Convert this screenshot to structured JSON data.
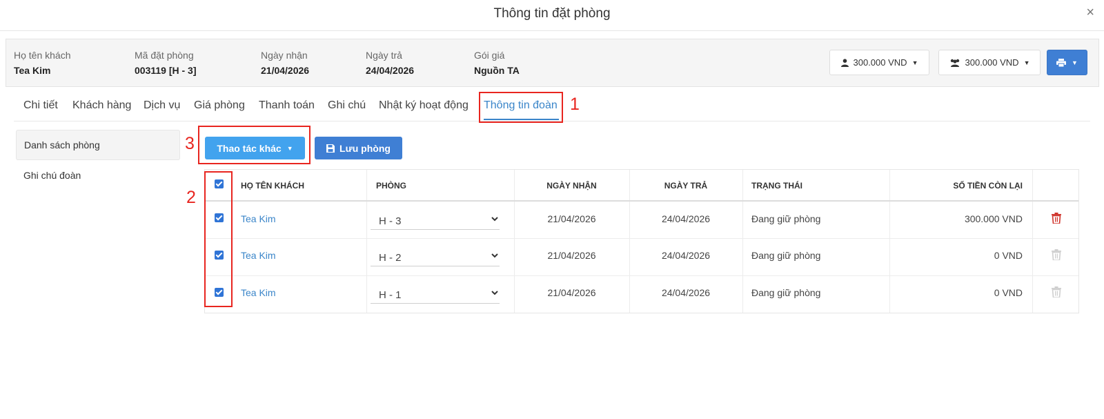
{
  "modal": {
    "title": "Thông tin đặt phòng",
    "close": "×"
  },
  "info": {
    "guest_label": "Họ tên khách",
    "guest_value": "Tea Kim",
    "code_label": "Mã đặt phòng",
    "code_value": "003119 [H - 3]",
    "checkin_label": "Ngày nhận",
    "checkin_value": "21/04/2026",
    "checkout_label": "Ngày trả",
    "checkout_value": "24/04/2026",
    "rate_label": "Gói giá",
    "rate_value": "Nguồn TA",
    "amount_single": "300.000 VND",
    "amount_group": "300.000 VND"
  },
  "tabs": [
    "Chi tiết",
    "Khách hàng",
    "Dịch vụ",
    "Giá phòng",
    "Thanh toán",
    "Ghi chú",
    "Nhật ký hoạt động",
    "Thông tin đoàn"
  ],
  "active_tab": "Thông tin đoàn",
  "sidebar": {
    "items": [
      "Danh sách phòng",
      "Ghi chú đoàn"
    ]
  },
  "toolbar": {
    "more_actions": "Thao tác khác",
    "save_room": "Lưu phòng"
  },
  "table": {
    "headers": [
      "HỌ TÊN KHÁCH",
      "PHÒNG",
      "NGÀY NHẬN",
      "NGÀY TRẢ",
      "TRẠNG THÁI",
      "SỐ TIỀN CÒN LẠI"
    ],
    "rows": [
      {
        "guest": "Tea Kim",
        "room": "H - 3",
        "checkin": "21/04/2026",
        "checkout": "24/04/2026",
        "status": "Đang giữ phòng",
        "remaining": "300.000 VND",
        "checked": true,
        "delete_enabled": true
      },
      {
        "guest": "Tea Kim",
        "room": "H - 2",
        "checkin": "21/04/2026",
        "checkout": "24/04/2026",
        "status": "Đang giữ phòng",
        "remaining": "0 VND",
        "checked": true,
        "delete_enabled": false
      },
      {
        "guest": "Tea Kim",
        "room": "H - 1",
        "checkin": "21/04/2026",
        "checkout": "24/04/2026",
        "status": "Đang giữ phòng",
        "remaining": "0 VND",
        "checked": true,
        "delete_enabled": false
      }
    ]
  },
  "annotations": [
    "1",
    "2",
    "3"
  ],
  "colors": {
    "accent": "#3a85c9",
    "button_primary": "#3f7fd4",
    "button_light": "#42a3ee",
    "annotation": "#e8251f",
    "danger": "#d0342c"
  }
}
